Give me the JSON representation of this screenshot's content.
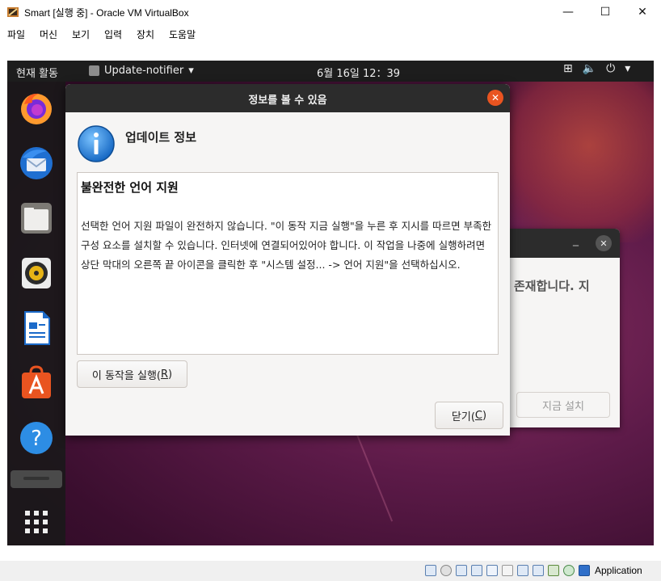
{
  "window": {
    "title": "Smart [실행 중] - Oracle VM VirtualBox",
    "minimize_glyph": "—",
    "maximize_glyph": "☐",
    "close_glyph": "✕"
  },
  "menubar": {
    "items": [
      {
        "label": "파일"
      },
      {
        "label": "머신"
      },
      {
        "label": "보기"
      },
      {
        "label": "입력"
      },
      {
        "label": "장치"
      },
      {
        "label": "도움말"
      }
    ]
  },
  "topbar": {
    "activities": "현재 활동",
    "app_menu": "Update-notifier",
    "app_menu_arrow": "▾",
    "clock": "6월 16일 12：39",
    "tray_network_glyph": "⊞",
    "tray_volume_glyph": "🔈",
    "tray_power_glyph": "⏻",
    "tray_arrow": "▾"
  },
  "dock": {
    "items": [
      {
        "name": "firefox-icon"
      },
      {
        "name": "thunderbird-icon"
      },
      {
        "name": "files-icon"
      },
      {
        "name": "rhythmbox-icon"
      },
      {
        "name": "libreoffice-writer-icon"
      },
      {
        "name": "ubuntu-software-icon"
      },
      {
        "name": "help-icon"
      }
    ]
  },
  "background_dialog": {
    "minimize_glyph": "_",
    "close_glyph": "✕",
    "text": "존재합니다. 지",
    "install_button": "지금 설치"
  },
  "dialog": {
    "title": "정보를 볼 수 있음",
    "close_glyph": "✕",
    "heading": "업데이트 정보",
    "content_title": "불완전한 언어 지원",
    "content_body": "선택한 언어 지원 파일이 완전하지 않습니다. \"이 동작 지금 실행\"을 누른 후 지시를 따르면 부족한 구성 요소를 설치할 수 있습니다. 인터넷에 연결되어있어야 합니다. 이 작업을 나중에 실행하려면 상단 막대의 오른쪽 끝 아이콘을 클릭한 후 \"시스템 설정... -> 언어 지원\"을 선택하십시오.",
    "run_button_text": "이 동작을 실행(",
    "run_button_key": "R",
    "run_button_end": ")",
    "close_button_text": "닫기(",
    "close_button_key": "C",
    "close_button_end": ")"
  },
  "statusbar": {
    "label": "Application"
  },
  "colors": {
    "ubuntu_orange": "#e95420",
    "header_dark": "#2c2c2c",
    "dock_bg": "#191919",
    "desktop_purple": "#5c1a48"
  }
}
